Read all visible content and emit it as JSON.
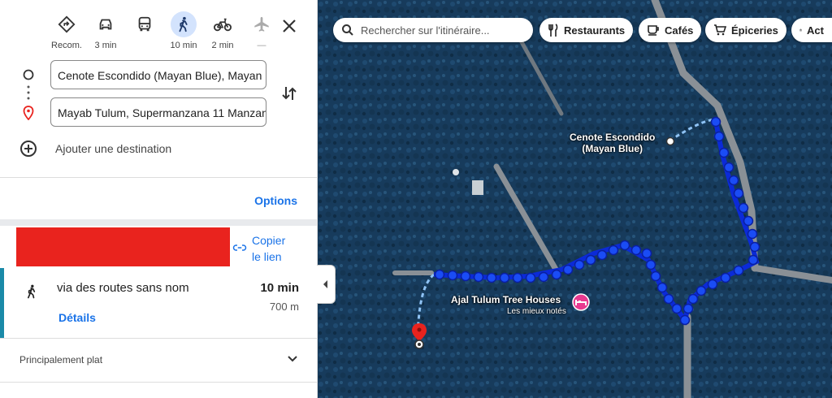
{
  "modes": [
    {
      "name": "recommended",
      "label": "Recom.",
      "active": false
    },
    {
      "name": "car",
      "label": "3 min",
      "active": false
    },
    {
      "name": "transit",
      "label": "",
      "active": false
    },
    {
      "name": "walk",
      "label": "10 min",
      "active": true
    },
    {
      "name": "bike",
      "label": "2 min",
      "active": false
    },
    {
      "name": "flight",
      "label": "—",
      "active": false
    }
  ],
  "origin": {
    "value": "Cenote Escondido (Mayan Blue), Mayan B"
  },
  "destination": {
    "value": "Mayab Tulum, Supermanzana 11 Manzana"
  },
  "add_destination": "Ajouter une destination",
  "options_label": "Options",
  "copy_link": {
    "line1": "Copier",
    "line2": "le lien"
  },
  "route": {
    "title": "via des routes sans nom",
    "time": "10 min",
    "distance": "700 m",
    "details": "Détails"
  },
  "terrain": "Principalement plat",
  "map": {
    "search_placeholder": "Rechercher sur l'itinéraire...",
    "chips": [
      "Restaurants",
      "Cafés",
      "Épiceries",
      "Act"
    ],
    "place1": {
      "line1": "Cenote Escondido",
      "line2": "(Mayan Blue)"
    },
    "place2": {
      "name": "Ajal Tulum Tree Houses",
      "sub": "Les mieux notés"
    }
  },
  "colors": {
    "accent": "#1a73e8",
    "route": "#1a4cf5",
    "active_mode_bg": "#d3e3fd",
    "marker_red": "#e9231e",
    "hotel_pink": "#e8398f"
  }
}
